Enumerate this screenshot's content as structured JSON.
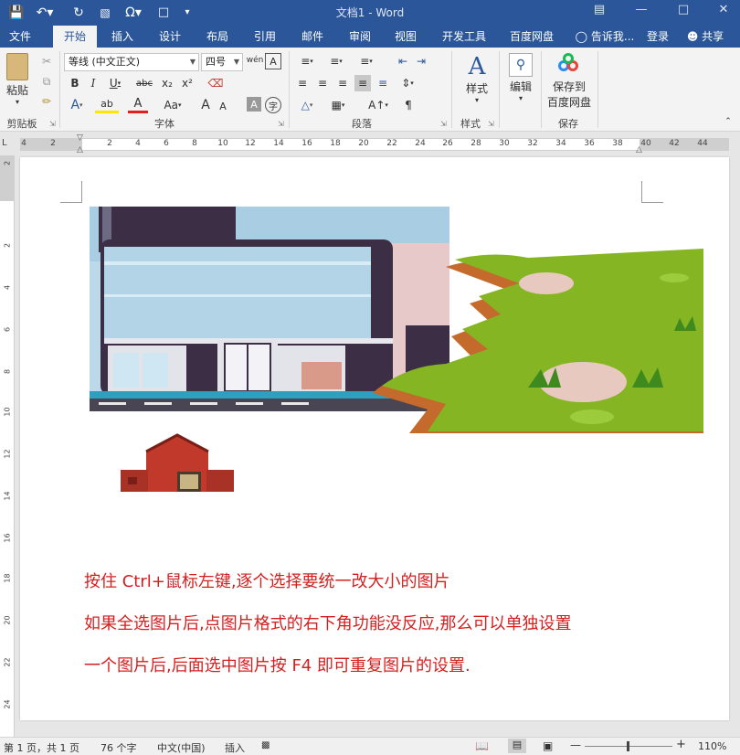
{
  "titlebar": {
    "title": "文档1 - Word",
    "save_icon": "save-icon",
    "undo_icon": "undo-icon",
    "redo_icon": "repeat-icon"
  },
  "tabs": [
    "文件",
    "开始",
    "插入",
    "设计",
    "布局",
    "引用",
    "邮件",
    "审阅",
    "视图",
    "开发工具",
    "百度网盘"
  ],
  "active_tab": "开始",
  "tell_me": "告诉我...",
  "login": "登录",
  "share": "共享",
  "ribbon": {
    "clipboard": {
      "paste": "粘贴",
      "group": "剪贴板"
    },
    "font": {
      "font_name": "等线 (中文正文)",
      "font_size": "四号",
      "bold": "B",
      "italic": "I",
      "underline": "U",
      "strike": "abc",
      "subscript": "x₂",
      "superscript": "x²",
      "grow": "A",
      "shrink": "A",
      "case": "Aa",
      "group": "字体"
    },
    "paragraph": {
      "group": "段落"
    },
    "styles": {
      "label": "样式",
      "group": "样式"
    },
    "editing": {
      "label": "编辑"
    },
    "save": {
      "label_line1": "保存到",
      "label_line2": "百度网盘",
      "group": "保存"
    }
  },
  "ruler": {
    "h_numbers": [
      "4",
      "2",
      "2",
      "4",
      "6",
      "8",
      "10",
      "12",
      "14",
      "16",
      "18",
      "20",
      "22",
      "24",
      "26",
      "28",
      "30",
      "32",
      "34",
      "36",
      "38",
      "40",
      "42",
      "44"
    ],
    "v_numbers": [
      "2",
      "2",
      "4",
      "6",
      "8",
      "10",
      "12",
      "14",
      "16",
      "18",
      "20",
      "22",
      "24"
    ]
  },
  "document": {
    "lines": [
      "按住 Ctrl+鼠标左键,逐个选择要统一改大小的图片",
      "如果全选图片后,点图片格式的右下角功能没反应,那么可以单独设置",
      "一个图片后,后面选中图片按 F4 即可重复图片的设置."
    ],
    "text_color": "#d42020"
  },
  "status": {
    "page": "第 1 页，共 1 页",
    "words": "76 个字",
    "lang": "中文(中国)",
    "mode": "插入",
    "zoom": "110%"
  },
  "colors": {
    "brand": "#2b579a",
    "ribbon_bg": "#f3f3f3"
  }
}
